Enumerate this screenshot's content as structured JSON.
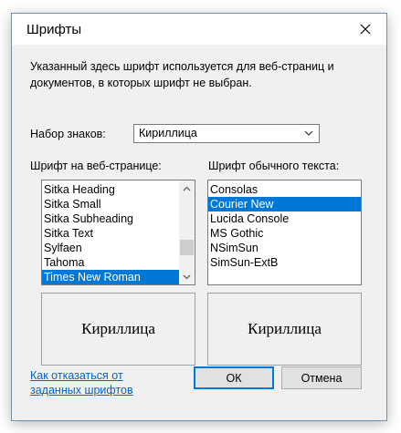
{
  "window": {
    "title": "Шрифты"
  },
  "description": {
    "line1": "Указанный здесь шрифт используется для веб-страниц и",
    "line2": "документов, в которых шрифт не выбран."
  },
  "charset": {
    "label": "Набор знаков:",
    "value": "Кириллица"
  },
  "web_font": {
    "label": "Шрифт на веб-странице:",
    "items": [
      "Sitka Heading",
      "Sitka Small",
      "Sitka Subheading",
      "Sitka Text",
      "Sylfaen",
      "Tahoma",
      "Times New Roman"
    ],
    "selected": "Times New Roman",
    "preview": "Кириллица"
  },
  "plain_font": {
    "label": "Шрифт обычного текста:",
    "items": [
      "Consolas",
      "Courier New",
      "Lucida Console",
      "MS Gothic",
      "NSimSun",
      "SimSun-ExtB"
    ],
    "selected": "Courier New",
    "preview": "Кириллица"
  },
  "link": {
    "line1": "Как отказаться от",
    "line2": "заданных шрифтов"
  },
  "buttons": {
    "ok": "ОК",
    "cancel": "Отмена"
  },
  "colors": {
    "selection": "#0078d7",
    "link": "#0066cc",
    "dialog_bg": "#f0f0f0"
  }
}
